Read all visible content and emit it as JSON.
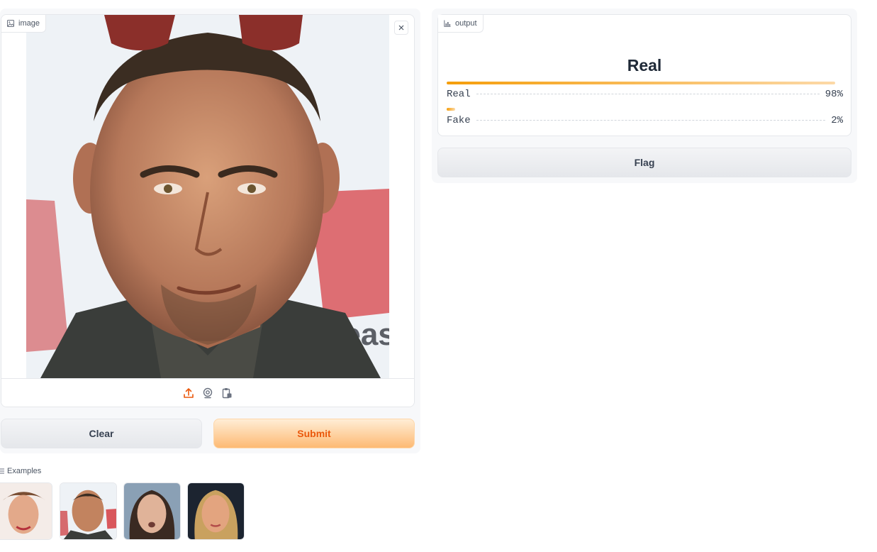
{
  "input_panel": {
    "label": "image",
    "label_icon": "image-icon",
    "toolbar_icons": [
      "upload-icon",
      "webcam-icon",
      "clipboard-icon"
    ]
  },
  "actions": {
    "clear_label": "Clear",
    "submit_label": "Submit",
    "flag_label": "Flag"
  },
  "output_panel": {
    "label": "output",
    "label_icon": "chart-icon",
    "predicted_label": "Real",
    "confidences": [
      {
        "label": "Real",
        "percent_text": "98%",
        "value": 0.98
      },
      {
        "label": "Fake",
        "percent_text": "2%",
        "value": 0.02
      }
    ]
  },
  "examples": {
    "label": "Examples",
    "label_icon": "list-icon",
    "count": 4
  },
  "colors": {
    "accent": "#ea580c",
    "bar_start": "#f59e0b",
    "bar_end": "#fcd9a8"
  }
}
